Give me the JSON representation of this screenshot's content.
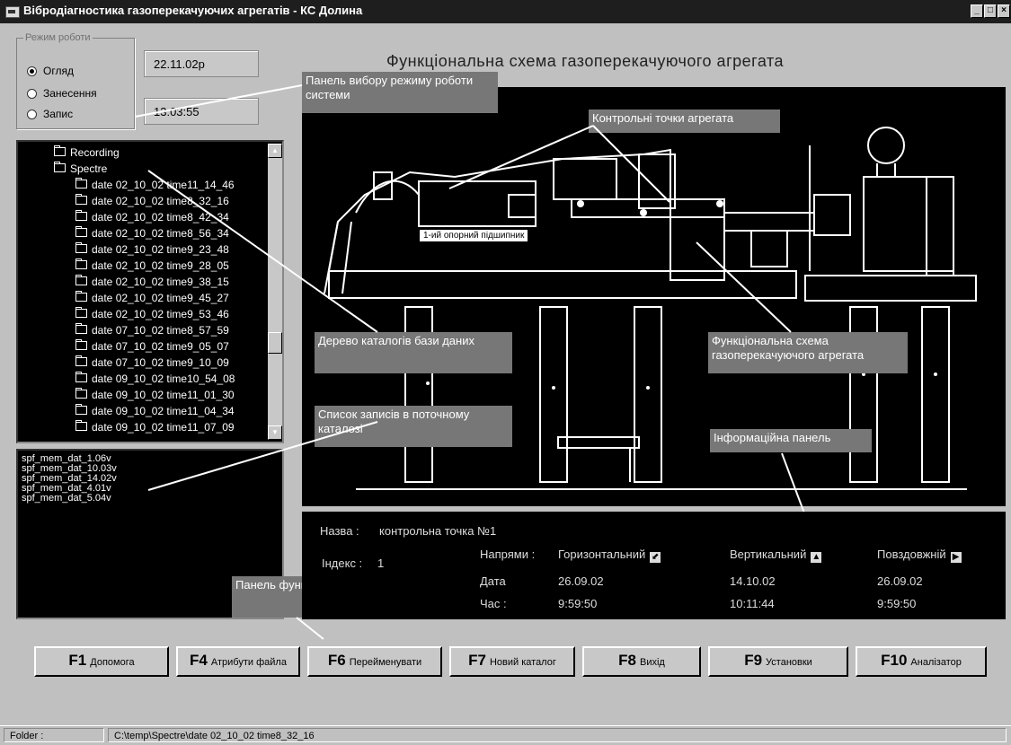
{
  "window": {
    "title": "Вібродіагностика газоперекачуючих агрегатів - КС Долина",
    "buttons": [
      "_",
      "□",
      "×"
    ]
  },
  "mode_panel": {
    "legend": "Режим роботи",
    "options": [
      {
        "label": "Огляд",
        "selected": true
      },
      {
        "label": "Занесення",
        "selected": false
      },
      {
        "label": "Запис",
        "selected": false
      }
    ],
    "date": "22.11.02р",
    "time": "13:03:55"
  },
  "tree": {
    "items": [
      {
        "label": "Recording",
        "level": 1
      },
      {
        "label": "Spectre",
        "level": 1
      },
      {
        "label": "date 02_10_02 time11_14_46",
        "level": 2
      },
      {
        "label": "date 02_10_02 time8_32_16",
        "level": 2
      },
      {
        "label": "date 02_10_02 time8_42_34",
        "level": 2
      },
      {
        "label": "date 02_10_02 time8_56_34",
        "level": 2
      },
      {
        "label": "date 02_10_02 time9_23_48",
        "level": 2
      },
      {
        "label": "date 02_10_02 time9_28_05",
        "level": 2
      },
      {
        "label": "date 02_10_02 time9_38_15",
        "level": 2
      },
      {
        "label": "date 02_10_02 time9_45_27",
        "level": 2
      },
      {
        "label": "date 02_10_02 time9_53_46",
        "level": 2
      },
      {
        "label": "date 07_10_02 time8_57_59",
        "level": 2
      },
      {
        "label": "date 07_10_02 time9_05_07",
        "level": 2
      },
      {
        "label": "date 07_10_02 time9_10_09",
        "level": 2
      },
      {
        "label": "date 09_10_02 time10_54_08",
        "level": 2
      },
      {
        "label": "date 09_10_02 time11_01_30",
        "level": 2
      },
      {
        "label": "date 09_10_02 time11_04_34",
        "level": 2
      },
      {
        "label": "date 09_10_02 time11_07_09",
        "level": 2
      }
    ]
  },
  "records": [
    "spf_mem_dat_1.06v",
    "spf_mem_dat_10.03v",
    "spf_mem_dat_14.02v",
    "spf_mem_dat_4.01v",
    "spf_mem_dat_5.04v"
  ],
  "schematic": {
    "title": "Функціональна схема газоперекачуючого агрегата",
    "bearing_label": "1-ий опорний підшипник"
  },
  "callouts": {
    "mode": "Панель вибору режиму роботи системи",
    "control_points": "Контрольні точки агрегата",
    "tree": "Дерево каталогів бази даних",
    "records": "Список записів в поточному каталозі",
    "functional": "Функціональна схема газоперекачуючого агрегата",
    "info": "Інформаційна панель",
    "buttons": "Панель функціональних кнопок"
  },
  "info_panel": {
    "name_label": "Назва :",
    "name_value": "контрольна точка №1",
    "index_label": "Індекс :",
    "index_value": "1",
    "directions_label": "Напрями :",
    "date_label": "Дата",
    "time_label": "Час :",
    "columns": [
      {
        "name": "Горизонтальний",
        "icon": "diagonal-arrow-icon",
        "glyph": "⬋",
        "date": "26.09.02",
        "time": "9:59:50"
      },
      {
        "name": "Вертикальний",
        "icon": "up-arrow-icon",
        "glyph": "▲",
        "date": "14.10.02",
        "time": "10:11:44"
      },
      {
        "name": "Повздовжній",
        "icon": "right-arrow-icon",
        "glyph": "▶",
        "date": "26.09.02",
        "time": "9:59:50"
      }
    ]
  },
  "function_buttons": [
    {
      "key": "F1",
      "label": "Допомога"
    },
    {
      "key": "F4",
      "label": "Атрибути файла"
    },
    {
      "key": "F6",
      "label": "Перейменувати"
    },
    {
      "key": "F7",
      "label": "Новий каталог"
    },
    {
      "key": "F8",
      "label": "Вихід"
    },
    {
      "key": "F9",
      "label": "Установки"
    },
    {
      "key": "F10",
      "label": "Аналізатор"
    }
  ],
  "status_bar": {
    "label": "Folder :",
    "path": "C:\\temp\\Spectre\\date 02_10_02 time8_32_16"
  }
}
